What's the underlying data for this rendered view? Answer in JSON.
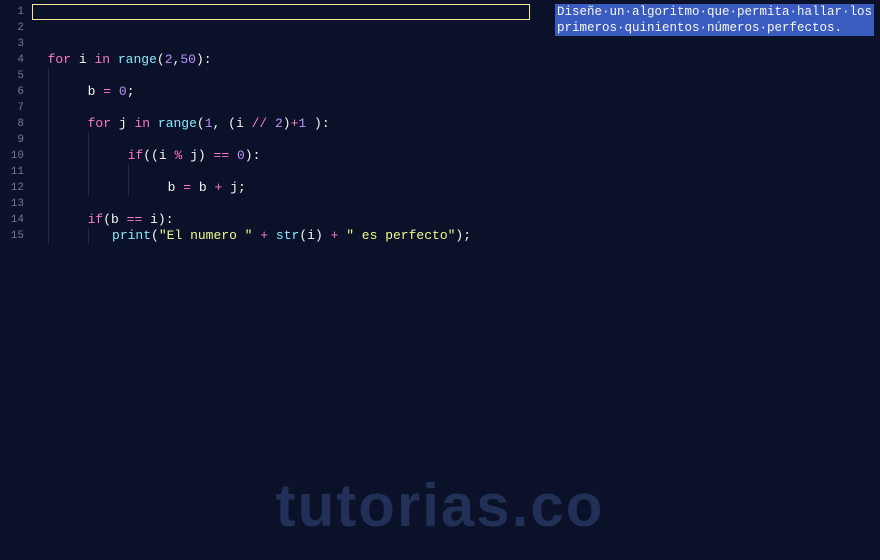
{
  "gutter": {
    "lines": [
      "1",
      "2",
      "3",
      "4",
      "5",
      "6",
      "7",
      "8",
      "9",
      "10",
      "11",
      "12",
      "13",
      "14",
      "15"
    ]
  },
  "docstring": {
    "line1": "Diseñe·un·algoritmo·que·permita·hallar·los",
    "line2": "primeros·quinientos·números·perfectos."
  },
  "code": {
    "l4": {
      "kw_for": "for",
      "var_i": "i",
      "kw_in": "in",
      "fn_range": "range",
      "args": "(2,50):",
      "n2": "2",
      "n50": "50"
    },
    "l6": {
      "var_b": "b",
      "op_eq": "=",
      "num_0": "0",
      "semi": ";"
    },
    "l8": {
      "kw_for": "for",
      "var_j": "j",
      "kw_in": "in",
      "fn_range": "range",
      "n1": "1",
      "var_i": "i",
      "op_div": "//",
      "n2": "2",
      "plus1": "+1",
      "close": "):"
    },
    "l10": {
      "kw_if": "if",
      "var_i": "i",
      "op_mod": "%",
      "var_j": "j",
      "op_eq": "==",
      "num_0": "0",
      "close": "):"
    },
    "l12": {
      "var_b": "b",
      "op_assign": "=",
      "var_b2": "b",
      "op_plus": "+",
      "var_j": "j",
      "semi": ";"
    },
    "l14": {
      "kw_if": "if",
      "var_b": "b",
      "op_eq": "==",
      "var_i": "i",
      "close": "):"
    },
    "l15": {
      "fn_print": "print",
      "str1": "\"El numero \"",
      "op_plus": "+",
      "fn_str": "str",
      "var_i": "i",
      "str2": "\" es perfecto\"",
      "semi": ";"
    }
  },
  "watermark": "tutorias.co"
}
